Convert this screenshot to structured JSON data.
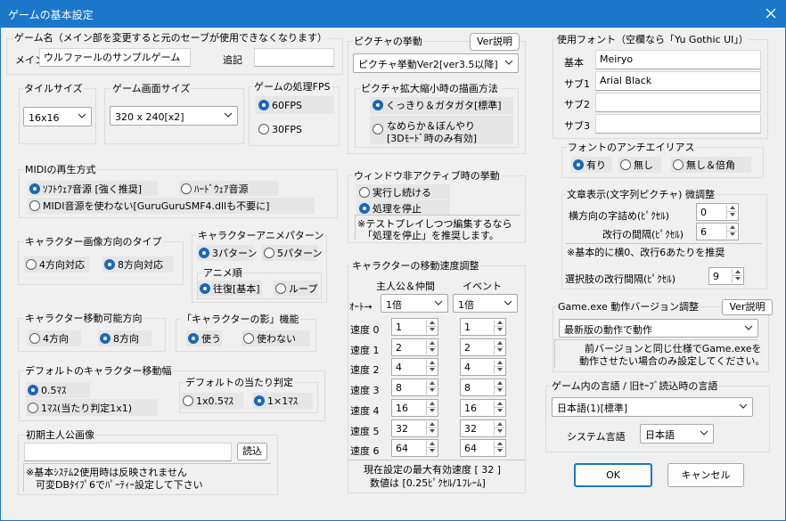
{
  "window": {
    "title": "ゲームの基本設定"
  },
  "game_name": {
    "group": "ゲーム名（メイン部を変更すると元のセーブが使用できなくなります）",
    "main_label": "メイン",
    "main_value": "ウルファールのサンプルゲーム",
    "suffix_label": "追記",
    "suffix_value": ""
  },
  "tile_size": {
    "group": "タイルサイズ",
    "value": "16x16"
  },
  "screen_size": {
    "group": "ゲーム画面サイズ",
    "value": "320 x 240[x2]"
  },
  "fps": {
    "group": "ゲームの処理FPS",
    "opt60": "60FPS",
    "opt30": "30FPS",
    "selected": "60FPS"
  },
  "picture": {
    "group": "ピクチャの挙動",
    "ver_button": "Ver説明",
    "behavior_value": "ピクチャ挙動Ver2[ver3.5以降]",
    "scale_group": "ピクチャ拡大縮小時の描画方法",
    "opt_sharp": "くっきり＆ガタガタ[標準]",
    "opt_smooth1": "なめらか＆ぼんやり",
    "opt_smooth2": "[3Dﾓｰﾄﾞ時のみ有効]"
  },
  "midi": {
    "group": "MIDIの再生方式",
    "opt_soft": "ｿﾌﾄｳｪｱ音源 [強く推奨]",
    "opt_hard": "ﾊｰﾄﾞｳｪｱ音源",
    "opt_none": "MIDI音源を使わない[GuruGuruSMF4.dllも不要に]"
  },
  "inactive": {
    "group": "ウィンドウ非アクティブ時の挙動",
    "opt_continue": "実行し続ける",
    "opt_stop": "処理を停止",
    "note1": "※テストプレイしつつ編集するなら",
    "note2": "「処理を停止」を推奨します。"
  },
  "char_dir": {
    "group": "キャラクター画像方向のタイプ",
    "opt4": "4方向対応",
    "opt8": "8方向対応"
  },
  "char_anim": {
    "group": "キャラクターアニメパターン",
    "opt3": "3パターン",
    "opt5": "5パターン",
    "order_group": "アニメ順",
    "opt_round": "往復[基本]",
    "opt_loop": "ループ"
  },
  "move_dir": {
    "group": "キャラクター移動可能方向",
    "opt4": "4方向",
    "opt8": "8方向"
  },
  "shadow": {
    "group": "「キャラクターの影」機能",
    "opt_use": "使う",
    "opt_nouse": "使わない"
  },
  "move_width": {
    "group": "デフォルトのキャラクター移動幅",
    "opt_half": "0.5ﾏｽ",
    "opt_one": "1ﾏｽ(当たり判定1x1)",
    "hit_group": "デフォルトの当たり判定",
    "hit_half": "1x0.5ﾏｽ",
    "hit_one": "1×1ﾏｽ"
  },
  "hero_image": {
    "group": "初期主人公画像",
    "value": "",
    "load_button": "読込",
    "note1": "※基本ｼｽﾃﾑ2使用時は反映されません",
    "note2": "可変DBﾀｲﾌﾟ6でﾊﾟｰﾃｨｰ設定して下さい"
  },
  "speed": {
    "group": "キャラクターの移動速度調整",
    "col_hero": "主人公＆仲間",
    "col_event": "イベント",
    "auto_label": "ｵｰﾄ→",
    "auto_hero": "1倍",
    "auto_event": "1倍",
    "rows": [
      {
        "label": "速度 0",
        "hero": "1",
        "event": "1"
      },
      {
        "label": "速度 1",
        "hero": "2",
        "event": "2"
      },
      {
        "label": "速度 2",
        "hero": "4",
        "event": "4"
      },
      {
        "label": "速度 3",
        "hero": "8",
        "event": "8"
      },
      {
        "label": "速度 4",
        "hero": "16",
        "event": "16"
      },
      {
        "label": "速度 5",
        "hero": "32",
        "event": "32"
      },
      {
        "label": "速度 6",
        "hero": "64",
        "event": "64"
      }
    ],
    "note1": "現在設定の最大有効速度 [ 32 ]",
    "note2": "数値は [0.25ﾋﾟｸｾﾙ/1ﾌﾚｰﾑ]"
  },
  "fonts": {
    "group": "使用フォント（空欄なら「Yu Gothic UI」）",
    "basic_label": "基本",
    "basic_value": "Meiryo",
    "sub1_label": "サブ1",
    "sub1_value": "Arial Black",
    "sub2_label": "サブ2",
    "sub2_value": "",
    "sub3_label": "サブ3",
    "sub3_value": ""
  },
  "antialias": {
    "group": "フォントのアンチエイリアス",
    "opt_on": "有り",
    "opt_off": "無し",
    "opt_off2x": "無し＆倍角"
  },
  "text_adjust": {
    "group": "文章表示(文字列ピクチャ) 微調整",
    "hspace_label": "横方向の字詰め(ﾋﾟｸｾﾙ)",
    "hspace_value": "0",
    "lspace_label": "改行の間隔(ﾋﾟｸｾﾙ)",
    "lspace_value": "6",
    "note": "※基本的に横0、改行6あたりを推奨",
    "choice_label": "選択肢の改行間隔(ﾋﾟｸｾﾙ)",
    "choice_value": "9"
  },
  "exe_version": {
    "group": "Game.exe 動作バージョン調整",
    "ver_button": "Ver説明",
    "value": "最新版の動作で動作",
    "note1": "前バージョンと同じ仕様でGame.exeを",
    "note2": "動作させたい場合のみ設定してください。"
  },
  "language": {
    "group": "ゲーム内の言語 / 旧ｾｰﾌﾞ読込時の言語",
    "value": "日本語(1)[標準]",
    "system_label": "システム言語",
    "system_value": "日本語"
  },
  "footer": {
    "ok": "OK",
    "cancel": "キャンセル"
  }
}
